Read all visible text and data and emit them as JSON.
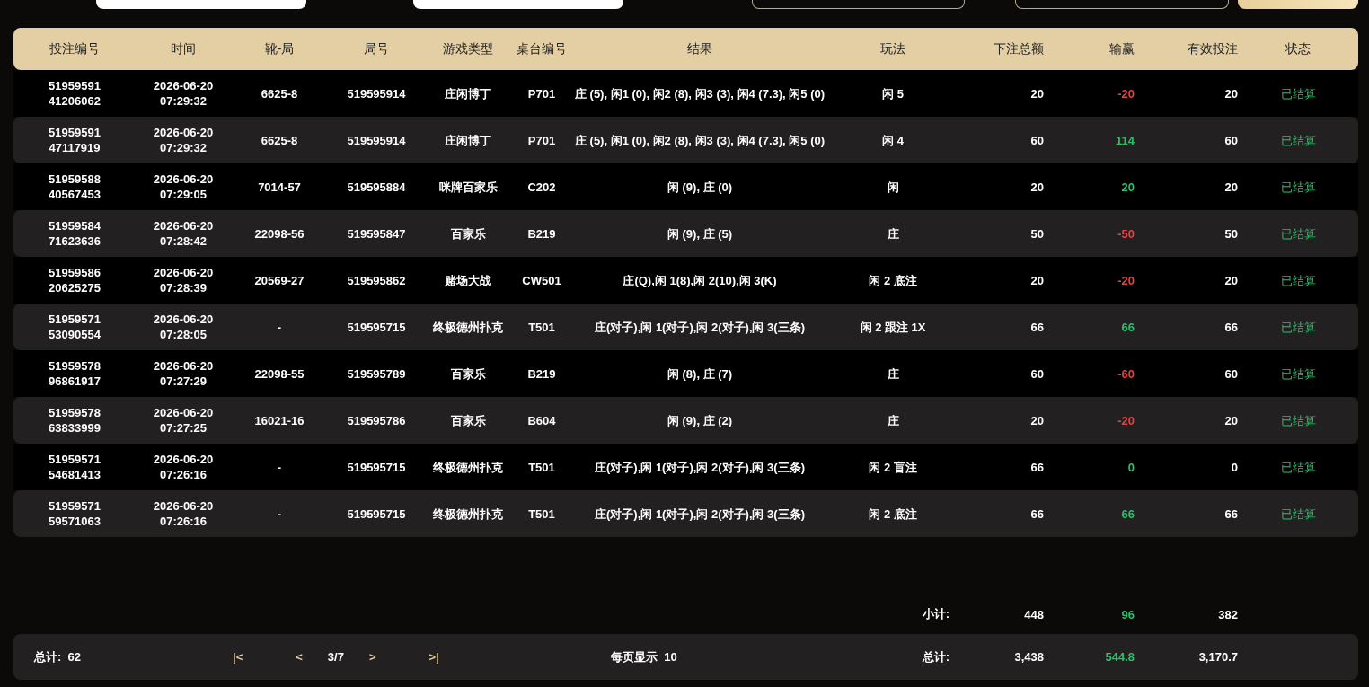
{
  "top_bar": {
    "fields": [
      {
        "kind": "solid"
      },
      {
        "kind": "solid"
      },
      {
        "kind": "outline"
      },
      {
        "kind": "outline"
      },
      {
        "kind": "button"
      }
    ]
  },
  "table": {
    "columns": [
      "投注编号",
      "时间",
      "靴-局",
      "局号",
      "游戏类型",
      "桌台编号",
      "结果",
      "玩法",
      "下注总额",
      "输赢",
      "有效投注",
      "状态"
    ],
    "rows": [
      {
        "bet_id": "5195959141206062",
        "time": "2026-06-20 07:29:32",
        "shoe_round": "6625-8",
        "round_id": "519595914",
        "game_type": "庄闲博丁",
        "table": "P701",
        "result": "庄 (5), 闲1 (0), 闲2 (8), 闲3 (3), 闲4 (7.3), 闲5 (0)",
        "play": "闲 5",
        "bet_total": "20",
        "win_loss": "-20",
        "color": "#e04444",
        "valid_bet": "20",
        "status": "已结算"
      },
      {
        "bet_id": "5195959147117919",
        "time": "2026-06-20 07:29:32",
        "shoe_round": "6625-8",
        "round_id": "519595914",
        "game_type": "庄闲博丁",
        "table": "P701",
        "result": "庄 (5), 闲1 (0), 闲2 (8), 闲3 (3), 闲4 (7.3), 闲5 (0)",
        "play": "闲 4",
        "bet_total": "60",
        "win_loss": "114",
        "color": "#2fbf6a",
        "valid_bet": "60",
        "status": "已结算"
      },
      {
        "bet_id": "5195958840567453",
        "time": "2026-06-20 07:29:05",
        "shoe_round": "7014-57",
        "round_id": "519595884",
        "game_type": "咪牌百家乐",
        "table": "C202",
        "result": "闲 (9), 庄 (0)",
        "play": "闲",
        "bet_total": "20",
        "win_loss": "20",
        "color": "#2fbf6a",
        "valid_bet": "20",
        "status": "已结算"
      },
      {
        "bet_id": "5195958471623636",
        "time": "2026-06-20 07:28:42",
        "shoe_round": "22098-56",
        "round_id": "519595847",
        "game_type": "百家乐",
        "table": "B219",
        "result": "闲 (9), 庄 (5)",
        "play": "庄",
        "bet_total": "50",
        "win_loss": "-50",
        "color": "#e04444",
        "valid_bet": "50",
        "status": "已结算"
      },
      {
        "bet_id": "5195958620625275",
        "time": "2026-06-20 07:28:39",
        "shoe_round": "20569-27",
        "round_id": "519595862",
        "game_type": "赌场大战",
        "table": "CW501",
        "result": "庄(Q),闲 1(8),闲 2(10),闲 3(K)",
        "play": "闲 2 底注",
        "bet_total": "20",
        "win_loss": "-20",
        "color": "#e04444",
        "valid_bet": "20",
        "status": "已结算"
      },
      {
        "bet_id": "5195957153090554",
        "time": "2026-06-20 07:28:05",
        "shoe_round": "-",
        "round_id": "519595715",
        "game_type": "终极德州扑克",
        "table": "T501",
        "result": "庄(对子),闲 1(对子),闲 2(对子),闲 3(三条)",
        "play": "闲 2 跟注 1X",
        "bet_total": "66",
        "win_loss": "66",
        "color": "#2fbf6a",
        "valid_bet": "66",
        "status": "已结算"
      },
      {
        "bet_id": "5195957896861917",
        "time": "2026-06-20 07:27:29",
        "shoe_round": "22098-55",
        "round_id": "519595789",
        "game_type": "百家乐",
        "table": "B219",
        "result": "闲 (8), 庄 (7)",
        "play": "庄",
        "bet_total": "60",
        "win_loss": "-60",
        "color": "#e04444",
        "valid_bet": "60",
        "status": "已结算"
      },
      {
        "bet_id": "5195957863833999",
        "time": "2026-06-20 07:27:25",
        "shoe_round": "16021-16",
        "round_id": "519595786",
        "game_type": "百家乐",
        "table": "B604",
        "result": "闲 (9), 庄 (2)",
        "play": "庄",
        "bet_total": "20",
        "win_loss": "-20",
        "color": "#e04444",
        "valid_bet": "20",
        "status": "已结算"
      },
      {
        "bet_id": "5195957154681413",
        "time": "2026-06-20 07:26:16",
        "shoe_round": "-",
        "round_id": "519595715",
        "game_type": "终极德州扑克",
        "table": "T501",
        "result": "庄(对子),闲 1(对子),闲 2(对子),闲 3(三条)",
        "play": "闲 2 盲注",
        "bet_total": "66",
        "win_loss": "0",
        "color": "#2fbf6a",
        "valid_bet": "0",
        "status": "已结算"
      },
      {
        "bet_id": "5195957159571063",
        "time": "2026-06-20 07:26:16",
        "shoe_round": "-",
        "round_id": "519595715",
        "game_type": "终极德州扑克",
        "table": "T501",
        "result": "庄(对子),闲 1(对子),闲 2(对子),闲 3(三条)",
        "play": "闲 2 底注",
        "bet_total": "66",
        "win_loss": "66",
        "color": "#2fbf6a",
        "valid_bet": "66",
        "status": "已结算"
      }
    ],
    "subtotal": {
      "label": "小计:",
      "bet_total": "448",
      "win_loss": "96",
      "valid_bet": "382"
    }
  },
  "footer": {
    "count": "总计:  62",
    "pagination": {
      "first": "|<",
      "prev": "<",
      "page": "3/7",
      "next": ">",
      "last": ">|"
    },
    "page_size": "每页显示  10",
    "total_label": "总计:",
    "bet_total": "3,438",
    "win_loss": "544.8",
    "valid_bet": "3,170.7"
  }
}
